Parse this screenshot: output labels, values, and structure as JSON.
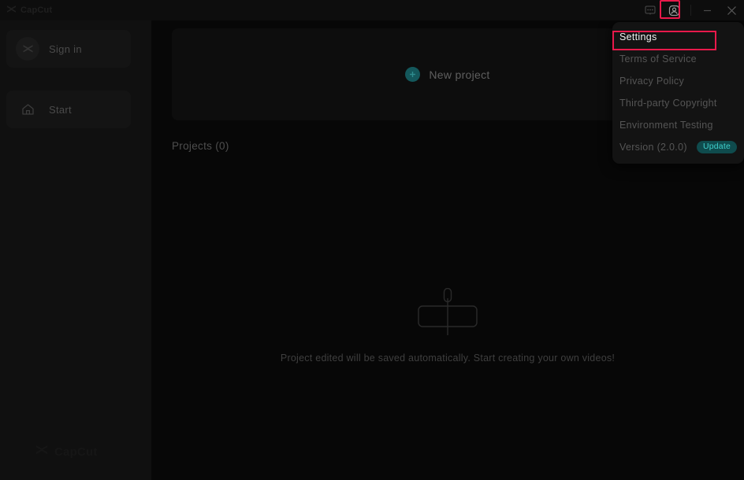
{
  "app": {
    "title": "CapCut",
    "watermark": "CapCut"
  },
  "titlebar": {
    "feedback_icon": "message-bubble-icon",
    "profile_icon": "account-avatar-icon",
    "minimize_label": "—",
    "close_label": "×"
  },
  "sidebar": {
    "items": [
      {
        "label": "Sign in",
        "icon": "capcut-avatar-icon"
      },
      {
        "label": "Start",
        "icon": "home-icon"
      }
    ]
  },
  "main": {
    "new_project_label": "New project",
    "new_project_icon": "plus-circle-icon",
    "projects_heading": "Projects (0)",
    "empty_state_icon": "timeline-clip-icon",
    "empty_state_text": "Project edited will be saved automatically. Start creating your own videos!"
  },
  "menu": {
    "items": [
      {
        "label": "Settings"
      },
      {
        "label": "Terms of Service"
      },
      {
        "label": "Privacy Policy"
      },
      {
        "label": "Third-party Copyright"
      },
      {
        "label": "Environment Testing"
      },
      {
        "label": "Version (2.0.0)"
      }
    ],
    "update_badge": "Update"
  },
  "colors": {
    "accent_teal": "#3fd0cd",
    "annotation_red": "#e8194b",
    "plus_teal": "#14585c",
    "background": "#0a0a0a",
    "sidebar_bg": "#101010",
    "panel_bg": "#131313"
  }
}
